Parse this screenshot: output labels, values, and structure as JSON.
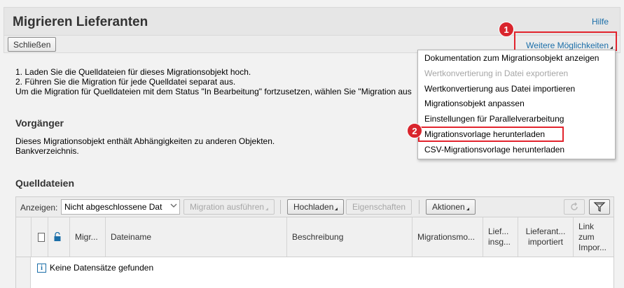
{
  "page": {
    "title": "Migrieren Lieferanten",
    "help": "Hilfe"
  },
  "toolbar": {
    "close_label": "Schließen",
    "more_label": "Weitere Möglichkeiten"
  },
  "badges": [
    "1",
    "2"
  ],
  "instructions": [
    "1. Laden Sie die Quelldateien für dieses Migrationsobjekt hoch.",
    "2. Führen Sie die Migration für jede Quelldatei separat aus.",
    "Um die Migration für Quelldateien mit dem Status \"In Bearbeitung\" fortzusetzen, wählen Sie \"Migration aus"
  ],
  "predecessor": {
    "heading": "Vorgänger",
    "line1": "Dieses Migrationsobjekt enthält Abhängigkeiten zu anderen Objekten.",
    "line2": "Bankverzeichnis."
  },
  "menu": {
    "items": [
      {
        "label": "Dokumentation zum Migrationsobjekt anzeigen",
        "disabled": false
      },
      {
        "label": "Wertkonvertierung in Datei exportieren",
        "disabled": true
      },
      {
        "label": "Wertkonvertierung aus Datei importieren",
        "disabled": false
      },
      {
        "label": "Migrationsobjekt anpassen",
        "disabled": false
      },
      {
        "label": "Einstellungen für Parallelverarbeitung",
        "disabled": false
      },
      {
        "label": "Migrationsvorlage herunterladen",
        "disabled": false,
        "highlighted": true
      },
      {
        "label": "CSV-Migrationsvorlage herunterladen",
        "disabled": false
      }
    ]
  },
  "source_files": {
    "heading": "Quelldateien",
    "show_label": "Anzeigen:",
    "filter_value": "Nicht abgeschlossene Dat",
    "run_migration": "Migration ausführen",
    "upload": "Hochladen",
    "properties": "Eigenschaften",
    "actions": "Aktionen",
    "columns": {
      "migration": "Migr...",
      "filename": "Dateiname",
      "description": "Beschreibung",
      "migration_mode": "Migrationsmo...",
      "supplier_total_1": "Lief...",
      "supplier_total_2": "insg...",
      "supplier_imported_1": "Lieferant...",
      "supplier_imported_2": "importiert",
      "link_1": "Link",
      "link_2": "zum",
      "link_3": "Impor..."
    },
    "empty_message": "Keine Datensätze gefunden"
  },
  "colors": {
    "accent_link": "#1b6ea8",
    "highlight_red": "#e2242d"
  }
}
